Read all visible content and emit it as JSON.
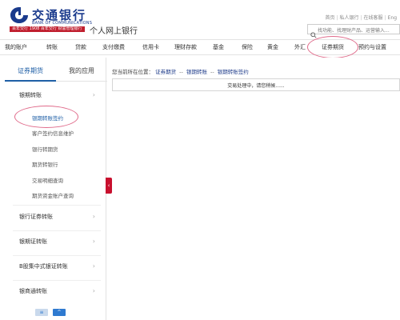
{
  "header": {
    "bank_name_cn": "交通银行",
    "bank_name_en": "BANK OF COMMUNICATIONS",
    "slogan": "百年交行 1908 百年交行 财富管理银行",
    "portal_title": "个人网上银行",
    "top_links": [
      "首页",
      "私人银行",
      "在线客服",
      "Eng"
    ],
    "search_placeholder": "找功能、找理财产品、运营输入..."
  },
  "nav": {
    "items": [
      "我的账户",
      "转账",
      "贷款",
      "支付缴费",
      "信用卡",
      "理财存款",
      "基金",
      "保险",
      "黄金",
      "外汇",
      "证券期货",
      "预约与设置"
    ],
    "active": "证券期货"
  },
  "sidebar": {
    "tabs": [
      "证券期货",
      "我的应用"
    ],
    "active_tab": "证券期货",
    "groups": [
      {
        "label": "银期转账",
        "subitems": [
          "银期转账签约",
          "客户签约信息维护",
          "银行转期货",
          "期货转银行",
          "交易明细查询",
          "期货资金账户查询"
        ],
        "active_subitem": "银期转账签约"
      },
      {
        "label": "银行证券转账"
      },
      {
        "label": "银期证转账"
      },
      {
        "label": "B股集中式银证转账"
      },
      {
        "label": "银商通转账"
      }
    ],
    "bottom_controls": [
      "≡",
      "^"
    ]
  },
  "content": {
    "breadcrumb_prefix": "您当前所在位置：",
    "breadcrumb": [
      "证券期货",
      "银期转账",
      "银期转账签约"
    ],
    "breadcrumb_separator": "--",
    "status_message": "交易处理中，请您稍候......"
  },
  "colors": {
    "brand_blue": "#1a3a8c",
    "brand_red": "#c8102e",
    "link_blue": "#1f5fa6",
    "highlight_circle": "#e06a8a"
  }
}
